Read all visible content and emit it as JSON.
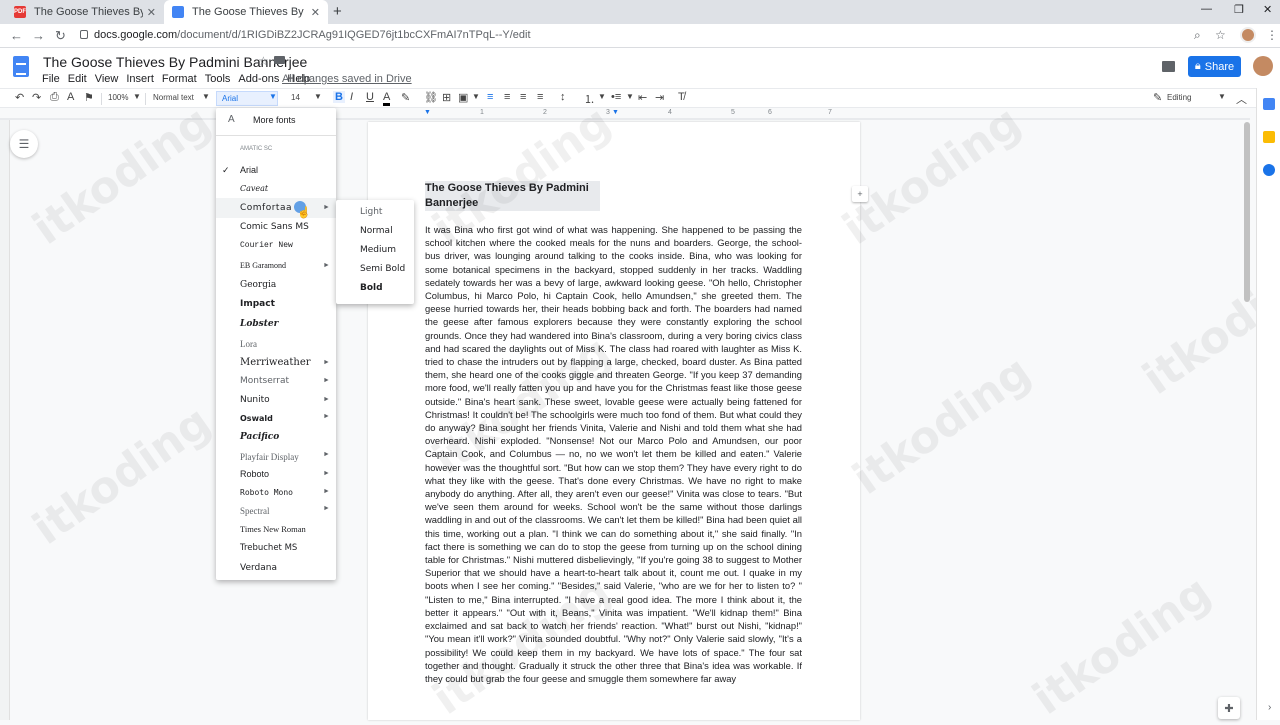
{
  "browser": {
    "tabs": [
      {
        "title": "The Goose Thieves By Padmini Ba",
        "icon": "pdf-icon"
      },
      {
        "title": "The Goose Thieves By Padmini Ba",
        "icon": "docs-icon"
      }
    ],
    "url_domain": "docs.google.com",
    "url_path": "/document/d/1RIGDiBZ2JCRAg91IQGED76jt1bcCXFmAI7nTPqL--Y/edit"
  },
  "doc": {
    "title": "The Goose Thieves By Padmini  Bannerjee",
    "menu": [
      "File",
      "Edit",
      "View",
      "Insert",
      "Format",
      "Tools",
      "Add-ons",
      "Help"
    ],
    "saved_status": "All changes saved in Drive",
    "share_label": "Share",
    "editing_label": "Editing"
  },
  "toolbar": {
    "zoom": "100%",
    "style": "Normal text",
    "font": "Arial",
    "size": "14"
  },
  "ruler": [
    "1",
    "2",
    "3",
    "4",
    "5",
    "6",
    "7"
  ],
  "font_menu": {
    "more_fonts": "More fonts",
    "section_label": "AMATIC SC",
    "items": [
      {
        "label": "Arial",
        "checked": true,
        "submenu": false
      },
      {
        "label": "Caveat",
        "checked": false,
        "submenu": false
      },
      {
        "label": "Comfortaa",
        "checked": false,
        "submenu": true
      },
      {
        "label": "Comic Sans MS",
        "checked": false,
        "submenu": false
      },
      {
        "label": "Courier New",
        "checked": false,
        "submenu": false
      },
      {
        "label": "EB Garamond",
        "checked": false,
        "submenu": true
      },
      {
        "label": "Georgia",
        "checked": false,
        "submenu": false
      },
      {
        "label": "Impact",
        "checked": false,
        "submenu": false
      },
      {
        "label": "Lobster",
        "checked": false,
        "submenu": false
      },
      {
        "label": "Lora",
        "checked": false,
        "submenu": false
      },
      {
        "label": "Merriweather",
        "checked": false,
        "submenu": true
      },
      {
        "label": "Montserrat",
        "checked": false,
        "submenu": true
      },
      {
        "label": "Nunito",
        "checked": false,
        "submenu": true
      },
      {
        "label": "Oswald",
        "checked": false,
        "submenu": true
      },
      {
        "label": "Pacifico",
        "checked": false,
        "submenu": false
      },
      {
        "label": "Playfair Display",
        "checked": false,
        "submenu": true
      },
      {
        "label": "Roboto",
        "checked": false,
        "submenu": true
      },
      {
        "label": "Roboto Mono",
        "checked": false,
        "submenu": true
      },
      {
        "label": "Spectral",
        "checked": false,
        "submenu": true
      },
      {
        "label": "Times New Roman",
        "checked": false,
        "submenu": false
      },
      {
        "label": "Trebuchet MS",
        "checked": false,
        "submenu": false
      },
      {
        "label": "Verdana",
        "checked": false,
        "submenu": false
      }
    ],
    "weights": [
      "Light",
      "Normal",
      "Medium",
      "Semi Bold",
      "Bold"
    ]
  },
  "content": {
    "heading_line1": "The Goose Thieves By Padmini",
    "heading_line2": "Bannerjee",
    "body": "It was Bina who first got wind of what was happening. She happened to be passing the school kitchen where the cooked meals for the nuns and boarders. George, the school- bus driver, was lounging around talking to the cooks inside. Bina, who was looking for some botanical specimens in the backyard, stopped suddenly in her tracks. Waddling sedately towards her was a bevy of large, awkward looking geese. \"Oh hello, Christopher Columbus, hi Marco Polo, hi Captain Cook, hello Amundsen,\" she greeted them. The geese hurried towards her, their heads bobbing back and forth. The boarders had named the geese after famous explorers because they were constantly exploring the school grounds. Once they had wandered into Bina's classroom, during a very boring civics class and had scared the daylights out of Miss K. The class had roared with laughter as Miss K. tried to chase the intruders out by flapping a large, checked, board duster. As Bina patted them, she heard one of the cooks giggle and threaten George. \"If you keep 37 demanding more food, we'll really fatten you up and have you for the Christmas feast like those geese outside.\" Bina's heart sank. These sweet, lovable geese were actually being fattened for Christmas! It couldn't be! The schoolgirls were much too fond of them. But what could they do anyway? Bina sought her friends Vinita, Valerie and Nishi and told them what she had overheard. Nishi exploded. \"Nonsense! Not our Marco Polo and Amundsen, our poor Captain Cook, and Columbus — no, no we won't let them be killed and eaten.\" Valerie however was the thoughtful sort. \"But how can we stop them? They have every right to do what they like with the geese. That's done every Christmas. We have no right to make anybody do anything. After all, they aren't even our geese!\" Vinita was close to tears. \"But we've seen them around for weeks. School won't be the same without those darlings waddling in and out of the classrooms. We can't let them be killed!\" Bina had been quiet all this time, working out a plan. \"I think we can do something about it,\" she said finally. \"In fact there is something we can do to stop the geese from turning up on the school dining table for Christmas.\" Nishi muttered disbelievingly, \"If you're going 38 to suggest to Mother Superior that we should have a heart-to-heart talk about it, count me out. I quake in my boots when I see her coming.\" \"Besides,\" said Valerie, \"who are we for her to listen to? \" \"Listen to me,\" Bina interrupted. \"I have a real good idea. The more I think about it, the better it appears.\" \"Out with it, Beans,\" Vinita was impatient. \"We'll kidnap them!\" Bina exclaimed and sat back to watch her friends' reaction. \"What!\" burst out Nishi, \"kidnap!\" \"You mean it'll work?\" Vinita sounded doubtful. \"Why not?\" Only Valerie said slowly, \"It's a possibility! We could keep them in my backyard. We have lots of space.\" The four sat together and thought. Gradually it struck the other three that Bina's idea was workable. If they could but grab the four geese and smuggle them somewhere far away"
  },
  "watermark": "itkoding"
}
